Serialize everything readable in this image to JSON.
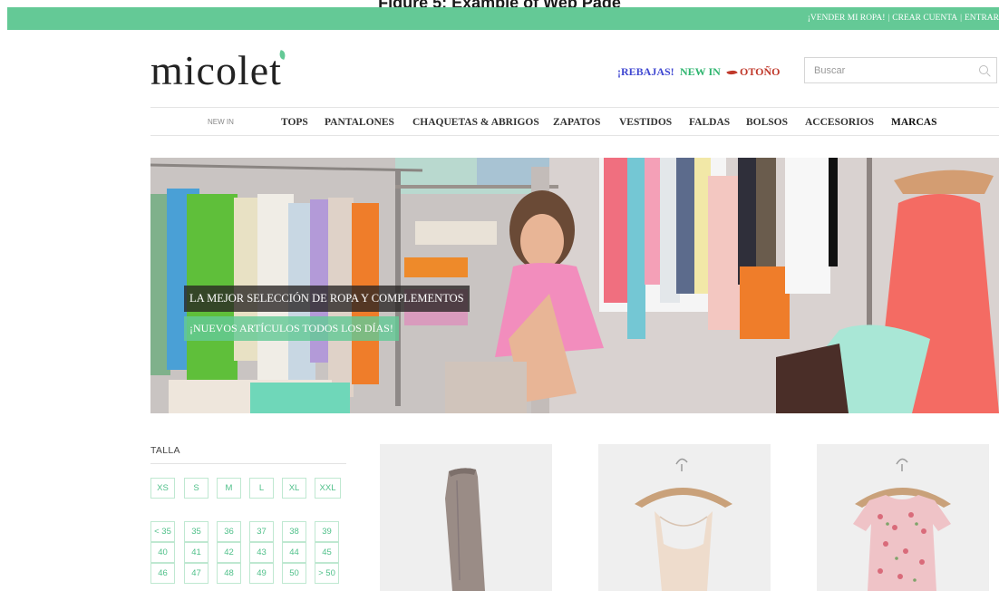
{
  "caption": "Figure 5: Example of Web Page",
  "topbar": {
    "links": [
      "¡VENDER MI ROPA!",
      "CREAR CUENTA",
      "ENTRAR"
    ],
    "separator": "|"
  },
  "logo": {
    "text": "micolet"
  },
  "promos": {
    "rebajas": "¡REBAJAS!",
    "new_in": "NEW IN",
    "otono": "OTOÑO"
  },
  "search": {
    "placeholder": "Buscar",
    "value": ""
  },
  "nav": {
    "items": [
      "NEW IN",
      "TOPS",
      "PANTALONES",
      "CHAQUETAS & ABRIGOS",
      "ZAPATOS",
      "VESTIDOS",
      "FALDAS",
      "BOLSOS",
      "ACCESORIOS",
      "MARCAS"
    ]
  },
  "hero": {
    "caption_1": "LA MEJOR SELECCIÓN DE ROPA Y COMPLEMENTOS",
    "caption_2": "¡NUEVOS ARTÍCULOS TODOS LOS DÍAS!"
  },
  "filter": {
    "title": "TALLA",
    "clothing_sizes": [
      "XS",
      "S",
      "M",
      "L",
      "XL",
      "XXL"
    ],
    "shoe_sizes": [
      "< 35",
      "35",
      "36",
      "37",
      "38",
      "39",
      "40",
      "41",
      "42",
      "43",
      "44",
      "45",
      "46",
      "47",
      "48",
      "49",
      "50",
      "> 50"
    ]
  },
  "products": [
    "boot-image",
    "silk-top-image",
    "floral-dress-image"
  ],
  "colors": {
    "brand_green": "#64c996",
    "rebajas_blue": "#3f47d1",
    "newin_green": "#2fb56f",
    "otono_red": "#c0392b",
    "size_text": "#50c08a"
  }
}
